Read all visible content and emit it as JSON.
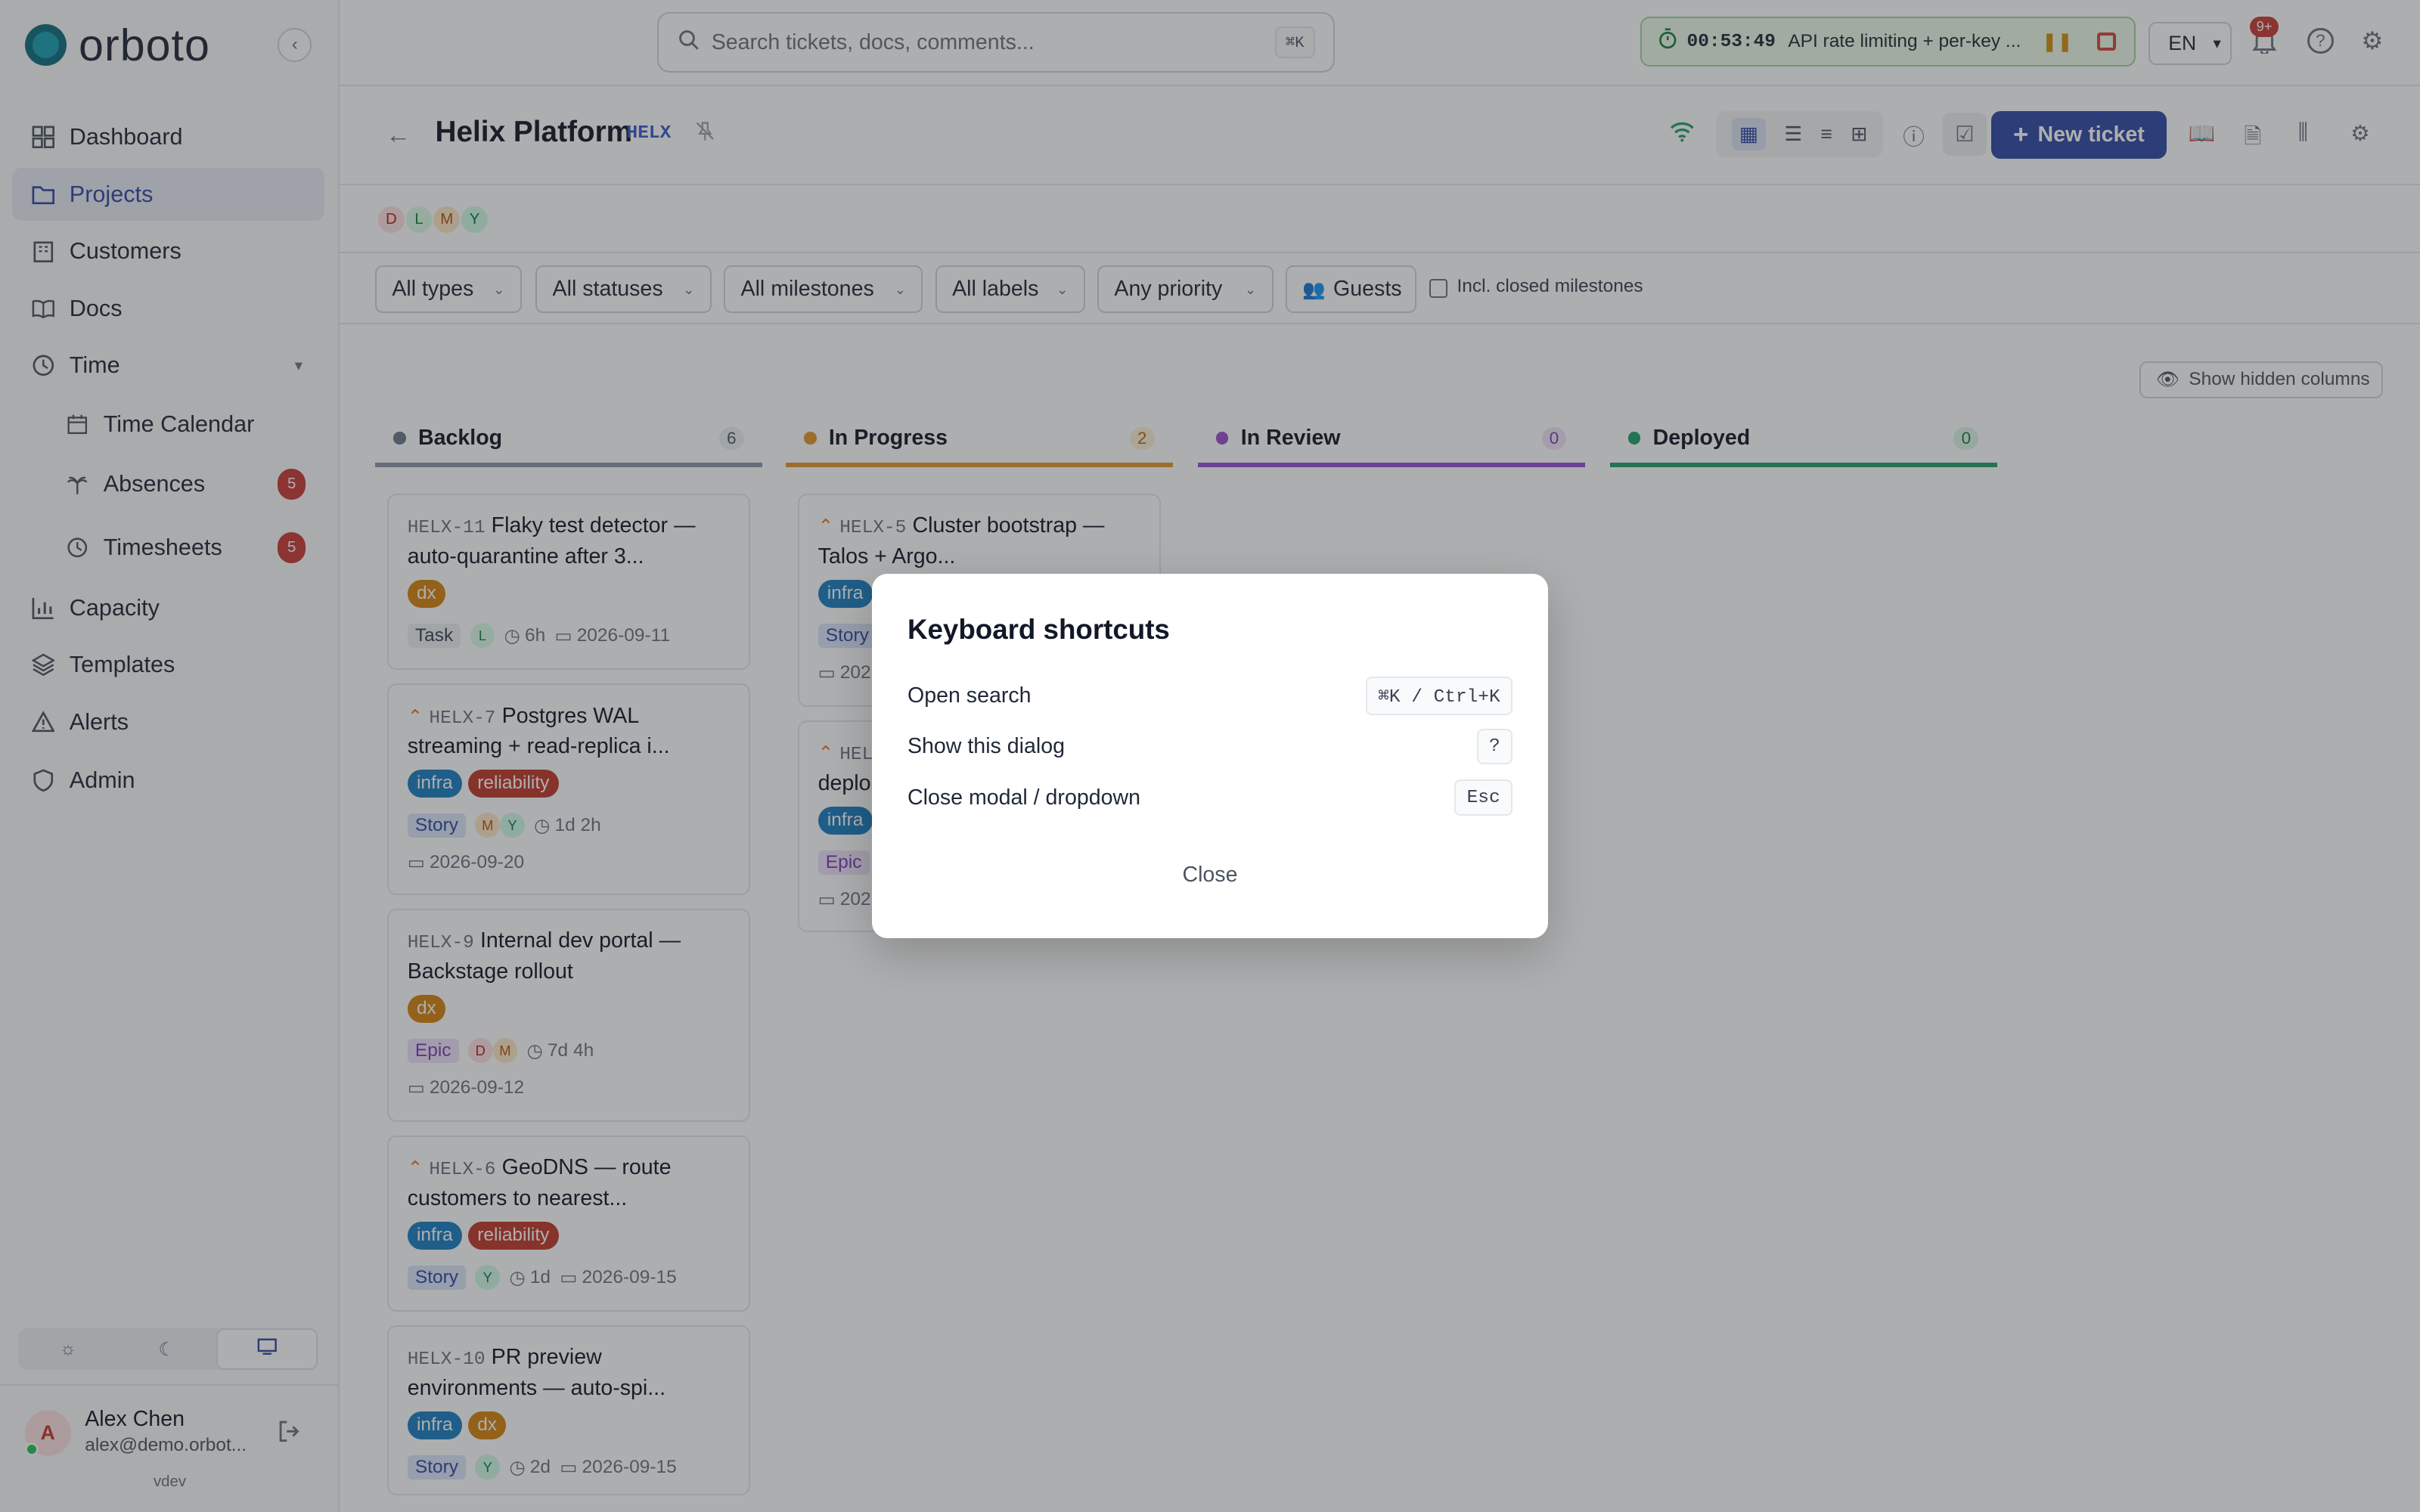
{
  "app": {
    "name": "orboto",
    "version": "vdev"
  },
  "sidebar": {
    "items": [
      {
        "label": "Dashboard"
      },
      {
        "label": "Projects"
      },
      {
        "label": "Customers"
      },
      {
        "label": "Docs"
      },
      {
        "label": "Time"
      },
      {
        "label": "Time Calendar"
      },
      {
        "label": "Absences",
        "badge": "5"
      },
      {
        "label": "Timesheets",
        "badge": "5"
      },
      {
        "label": "Capacity"
      },
      {
        "label": "Templates"
      },
      {
        "label": "Alerts"
      },
      {
        "label": "Admin"
      }
    ],
    "theme_options": [
      "light-icon",
      "dark-icon",
      "system-icon"
    ],
    "theme_selected": "system",
    "user": {
      "initial": "A",
      "name": "Alex Chen",
      "email": "alex@demo.orbot..."
    }
  },
  "topbar": {
    "search_placeholder": "Search tickets, docs, comments...",
    "search_shortcut": "⌘K",
    "timer": {
      "time": "00:53:49",
      "description": "API rate limiting + per-key ..."
    },
    "language": "EN",
    "notifications": "9+"
  },
  "project": {
    "name": "Helix Platform",
    "key": "HELX",
    "members": [
      "D",
      "L",
      "M",
      "Y"
    ],
    "new_ticket_label": "New ticket"
  },
  "filters": {
    "types": "All types",
    "statuses": "All statuses",
    "milestones": "All milestones",
    "labels": "All labels",
    "priority": "Any priority",
    "guests": "Guests",
    "closed_milestones": "Incl. closed milestones"
  },
  "board": {
    "show_hidden_label": "Show hidden columns",
    "columns": [
      {
        "name": "Backlog",
        "count": "6",
        "color": "#6b7a90"
      },
      {
        "name": "In Progress",
        "count": "2",
        "color": "#e09a2b"
      },
      {
        "name": "In Review",
        "count": "0",
        "color": "#9b4fd6"
      },
      {
        "name": "Deployed",
        "count": "0",
        "color": "#22a06b"
      }
    ],
    "backlog_cards": [
      {
        "key": "HELX-11",
        "title": "Flaky test detector — auto-quarantine after 3...",
        "labels": [
          "dx"
        ],
        "type": "Task",
        "assignees": [
          "L"
        ],
        "estimate": "6h",
        "due": "2026-09-11",
        "priority": false
      },
      {
        "key": "HELX-7",
        "title": "Postgres WAL streaming + read-replica i...",
        "labels": [
          "infra",
          "reliability"
        ],
        "type": "Story",
        "assignees": [
          "M",
          "Y"
        ],
        "estimate": "1d 2h",
        "due": "2026-09-20",
        "priority": true
      },
      {
        "key": "HELX-9",
        "title": "Internal dev portal — Backstage rollout",
        "labels": [
          "dx"
        ],
        "type": "Epic",
        "assignees": [
          "D",
          "M"
        ],
        "estimate": "7d 4h",
        "due": "2026-09-12",
        "priority": false
      },
      {
        "key": "HELX-6",
        "title": "GeoDNS — route customers to nearest...",
        "labels": [
          "infra",
          "reliability"
        ],
        "type": "Story",
        "assignees": [
          "Y"
        ],
        "estimate": "1d",
        "due": "2026-09-15",
        "priority": true
      },
      {
        "key": "HELX-10",
        "title": "PR preview environments — auto-spi...",
        "labels": [
          "infra",
          "dx"
        ],
        "type": "Story",
        "assignees": [
          "Y"
        ],
        "estimate": "2d",
        "due": "2026-09-15",
        "priority": false
      }
    ],
    "progress_cards": [
      {
        "key": "HELX-5",
        "title": "Cluster bootstrap — Talos + Argo...",
        "labels": [
          "infra"
        ],
        "type": "Story",
        "due": "202",
        "priority": true
      },
      {
        "key": "HEL",
        "title": "deplo",
        "labels": [
          "infra"
        ],
        "type": "Epic",
        "due": "202",
        "priority": true
      }
    ]
  },
  "modal": {
    "title": "Keyboard shortcuts",
    "shortcuts": [
      {
        "action": "Open search",
        "keys": "⌘K / Ctrl+K"
      },
      {
        "action": "Show this dialog",
        "keys": "?"
      },
      {
        "action": "Close modal / dropdown",
        "keys": "Esc"
      }
    ],
    "close_label": "Close"
  },
  "colors": {
    "accent": "#2f49a5",
    "label_infra": "#1a7fc1",
    "label_dx": "#d6840f",
    "label_reliability": "#c0392b"
  }
}
